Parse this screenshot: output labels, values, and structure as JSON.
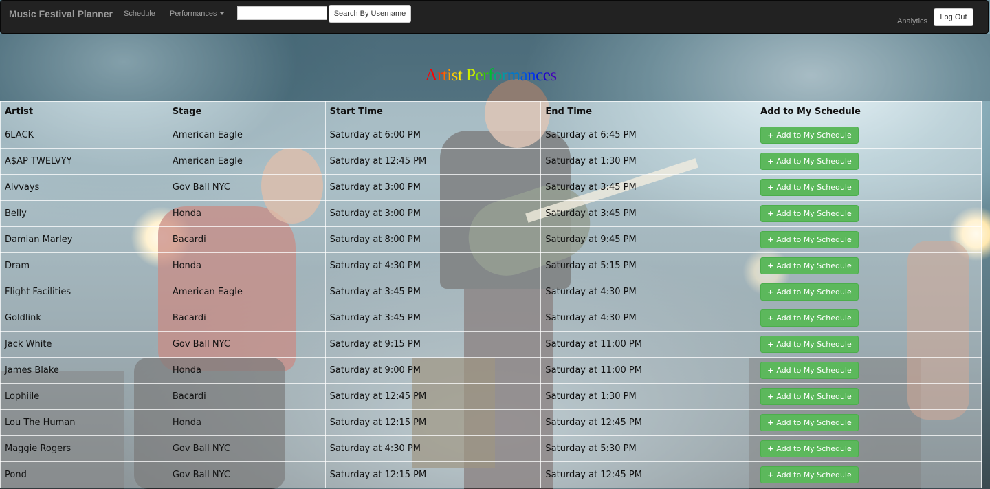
{
  "navbar": {
    "brand": "Music Festival Planner",
    "schedule_label": "Schedule",
    "performances_label": "Performances",
    "search_value": "",
    "search_button": "Search By Username",
    "analytics_label": "Analytics",
    "logout_label": "Log Out"
  },
  "page_title": "Artist Performances",
  "title_letters": [
    "A",
    "r",
    "t",
    "i",
    "s",
    "t",
    " ",
    "P",
    "e",
    "r",
    "f",
    "o",
    "r",
    "m",
    "a",
    "n",
    "c",
    "e",
    "s"
  ],
  "table": {
    "headers": [
      "Artist",
      "Stage",
      "Start Time",
      "End Time",
      "Add to My Schedule"
    ],
    "button_label": "Add to My Schedule",
    "rows": [
      {
        "artist": "6LACK",
        "stage": "American Eagle",
        "start": "Saturday at 6:00 PM",
        "end": "Saturday at 6:45 PM"
      },
      {
        "artist": "A$AP TWELVYY",
        "stage": "American Eagle",
        "start": "Saturday at 12:45 PM",
        "end": "Saturday at 1:30 PM"
      },
      {
        "artist": "Alvvays",
        "stage": "Gov Ball NYC",
        "start": "Saturday at 3:00 PM",
        "end": "Saturday at 3:45 PM"
      },
      {
        "artist": "Belly",
        "stage": "Honda",
        "start": "Saturday at 3:00 PM",
        "end": "Saturday at 3:45 PM"
      },
      {
        "artist": "Damian Marley",
        "stage": "Bacardi",
        "start": "Saturday at 8:00 PM",
        "end": "Saturday at 9:45 PM"
      },
      {
        "artist": "Dram",
        "stage": "Honda",
        "start": "Saturday at 4:30 PM",
        "end": "Saturday at 5:15 PM"
      },
      {
        "artist": "Flight Facilities",
        "stage": "American Eagle",
        "start": "Saturday at 3:45 PM",
        "end": "Saturday at 4:30 PM"
      },
      {
        "artist": "Goldlink",
        "stage": "Bacardi",
        "start": "Saturday at 3:45 PM",
        "end": "Saturday at 4:30 PM"
      },
      {
        "artist": "Jack White",
        "stage": "Gov Ball NYC",
        "start": "Saturday at 9:15 PM",
        "end": "Saturday at 11:00 PM"
      },
      {
        "artist": "James Blake",
        "stage": "Honda",
        "start": "Saturday at 9:00 PM",
        "end": "Saturday at 11:00 PM"
      },
      {
        "artist": "Lophiile",
        "stage": "Bacardi",
        "start": "Saturday at 12:45 PM",
        "end": "Saturday at 1:30 PM"
      },
      {
        "artist": "Lou The Human",
        "stage": "Honda",
        "start": "Saturday at 12:15 PM",
        "end": "Saturday at 12:45 PM"
      },
      {
        "artist": "Maggie Rogers",
        "stage": "Gov Ball NYC",
        "start": "Saturday at 4:30 PM",
        "end": "Saturday at 5:30 PM"
      },
      {
        "artist": "Pond",
        "stage": "Gov Ball NYC",
        "start": "Saturday at 12:15 PM",
        "end": "Saturday at 12:45 PM"
      }
    ]
  },
  "colors": {
    "navbar_bg": "#222222",
    "nav_text": "#9d9d9d",
    "button_green": "#5cb85c",
    "title_rainbow": [
      "#ff0000",
      "#ff3300",
      "#ff6600",
      "#ff9900",
      "#ffcc00",
      "#ffee00",
      "#ffff00",
      "#ccee00",
      "#88dd00",
      "#33cc00",
      "#00bb33",
      "#00aa77",
      "#0099aa",
      "#0077cc",
      "#0055dd",
      "#0033ee",
      "#0022dd",
      "#2200cc",
      "#4400bb"
    ]
  },
  "icons": {
    "add": "plus-icon",
    "dropdown": "caret-down-icon"
  }
}
